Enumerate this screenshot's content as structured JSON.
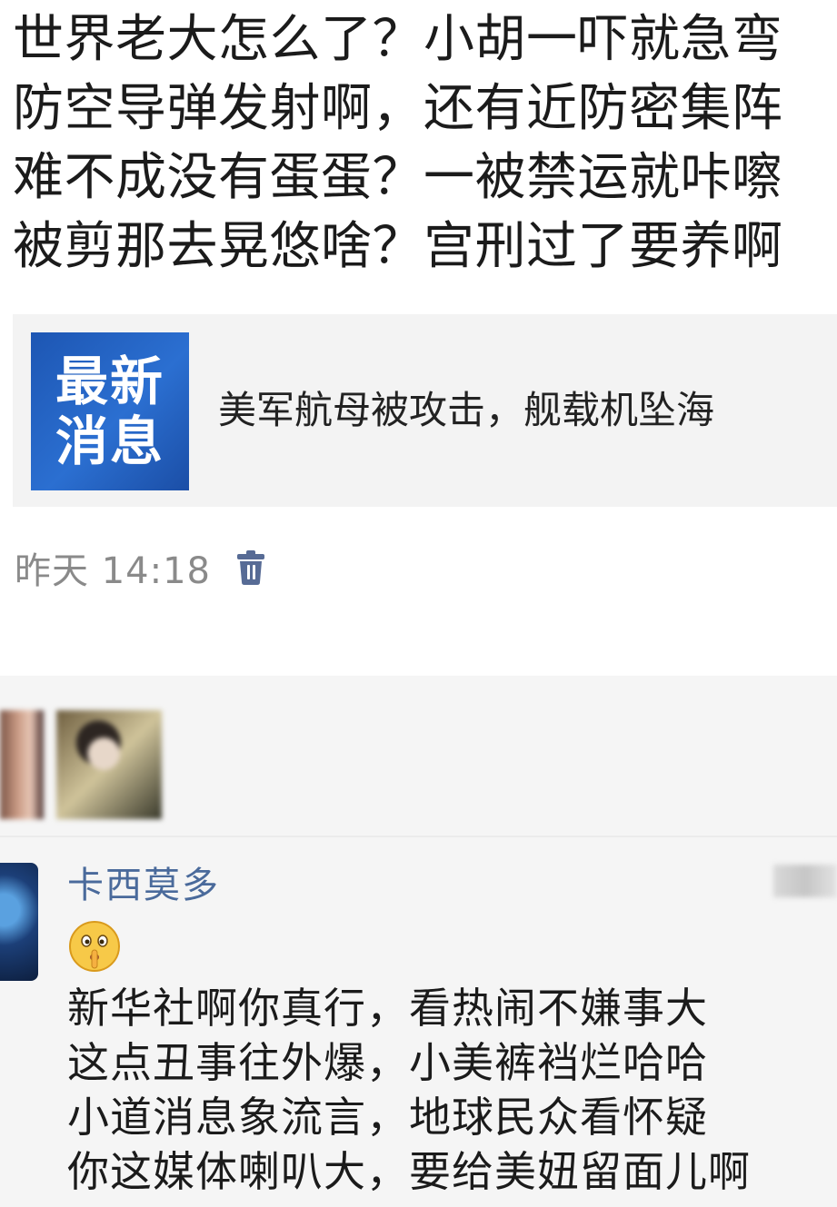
{
  "poem": {
    "lines": [
      "世界老大怎么了？小胡一吓就急弯",
      "防空导弹发射啊，还有近防密集阵",
      "难不成没有蛋蛋？一被禁运就咔嚓",
      "被剪那去晃悠啥？宫刑过了要养啊"
    ]
  },
  "news_card": {
    "thumb_line1": "最新",
    "thumb_line2": "消息",
    "title": "美军航母被攻击，舰载机坠海"
  },
  "post_meta": {
    "time": "昨天 14:18",
    "delete_icon": "trash-icon",
    "icon_color": "#576b95"
  },
  "comment": {
    "author": "卡西莫多",
    "emoji": "shush-face",
    "lines": [
      "新华社啊你真行，看热闹不嫌事大",
      "这点丑事往外爆，小美裤裆烂哈哈",
      "小道消息象流言，地球民众看怀疑",
      "你这媒体喇叭大，要给美妞留面儿啊"
    ]
  },
  "colors": {
    "news_thumb": "#1d56b3",
    "author_name": "#4a6a9b",
    "time_text": "#8a8a8a",
    "card_bg": "#f3f3f3"
  }
}
